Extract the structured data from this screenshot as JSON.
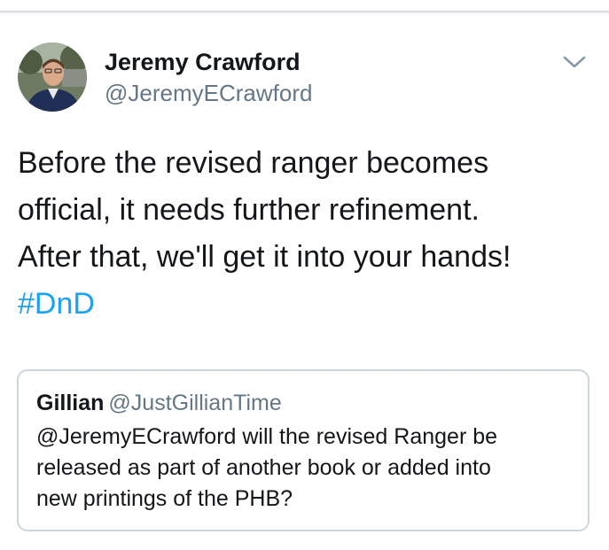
{
  "author": {
    "display_name": "Jeremy Crawford",
    "handle": "@JeremyECrawford",
    "avatar_icon": "profile-photo"
  },
  "menu": {
    "icon": "chevron-down-icon"
  },
  "tweet": {
    "lines": [
      "Before the revised ranger becomes",
      "official, it needs further refinement.",
      "After that, we'll get it into your hands!"
    ],
    "hashtag": "#DnD"
  },
  "quoted_tweet": {
    "display_name": "Gillian",
    "handle": "@JustGillianTime",
    "lines": [
      "@JeremyECrawford will the revised Ranger be",
      "released as part of another book or added into",
      "new printings of the PHB?"
    ]
  },
  "colors": {
    "link": "#1da1f2",
    "secondary_text": "#657786",
    "primary_text": "#14171a",
    "card_border": "#ccd6dd"
  }
}
